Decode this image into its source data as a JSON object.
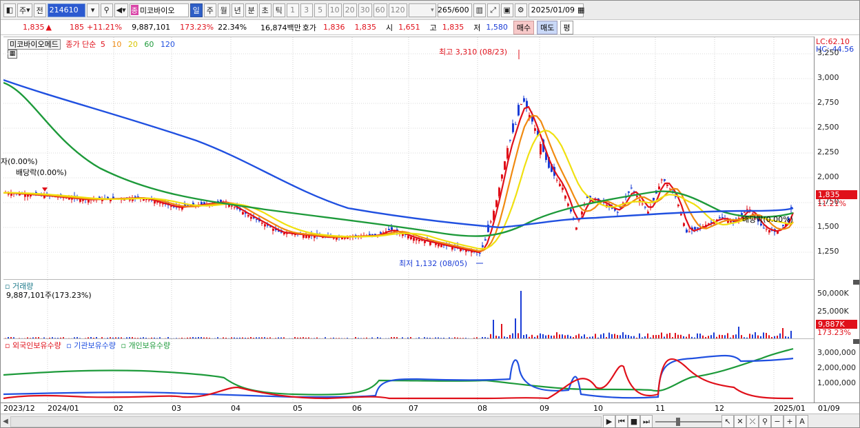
{
  "toolbar": {
    "mode1": "주",
    "mode2": "전",
    "code": "214610",
    "name_badge": "종",
    "name": "미코바이오",
    "periods": [
      "일",
      "주",
      "월",
      "년",
      "분",
      "초",
      "틱"
    ],
    "intervals": [
      "1",
      "3",
      "5",
      "10",
      "20",
      "30",
      "60",
      "120"
    ],
    "count": "265",
    "count_total": "/600",
    "date": "2025/01/09"
  },
  "quote": {
    "price": "1,835",
    "change": "185",
    "change_pct": "+11.21%",
    "volume": "9,887,101",
    "volume_pct": "173.23%",
    "turnover": "22.34%",
    "amount": "16,874백만",
    "ask_label": "호가",
    "ask1": "1,836",
    "ask2": "1,835",
    "open_label": "시",
    "open": "1,651",
    "high_label": "고",
    "high": "1,835",
    "low_label": "저",
    "low": "1,580",
    "buy_btn": "매수",
    "sell_btn": "매도",
    "avg_btn": "평"
  },
  "price_pane": {
    "legend_name": "미코바이오메드",
    "legend_ma": "종가 단순",
    "ma_periods": [
      "5",
      "10",
      "20",
      "60",
      "120"
    ],
    "ma_colors": [
      "#e0101a",
      "#f08a10",
      "#f0e010",
      "#1d9a3a",
      "#2050e0"
    ],
    "lc": "LC:62.10",
    "hc": "HC:-44.56",
    "high_annot": "최고 3,310 (08/23)",
    "low_annot": "최저 1,132 (08/05)",
    "div_annot1": "자(0.00%)",
    "div_annot2": "배당락(0.00%)",
    "div_annot3": "배당락(0.00%)",
    "y_ticks": [
      "3,250",
      "3,000",
      "2,750",
      "2,500",
      "2,250",
      "2,000",
      "1,750",
      "1,500",
      "1,250"
    ],
    "cur_price": "1,835",
    "cur_pct": "11.21%"
  },
  "volume_pane": {
    "title": "거래량",
    "value": "9,887,101주(173.23%)",
    "y_ticks": [
      "50,000K",
      "25,000K"
    ],
    "cur_value": "9,887K",
    "cur_pct": "173.23%"
  },
  "holding_pane": {
    "legend": [
      "외국인보유수량",
      "기관보유수량",
      "개인보유수량"
    ],
    "colors": [
      "#e0101a",
      "#2050e0",
      "#1d9a3a"
    ],
    "y_ticks": [
      "3,000,000",
      "2,000,000",
      "1,000,000"
    ]
  },
  "x_labels": [
    "2023/12",
    "2024/01",
    "02",
    "03",
    "04",
    "05",
    "06",
    "07",
    "08",
    "09",
    "10",
    "11",
    "12",
    "2025/01",
    "01/09"
  ]
}
